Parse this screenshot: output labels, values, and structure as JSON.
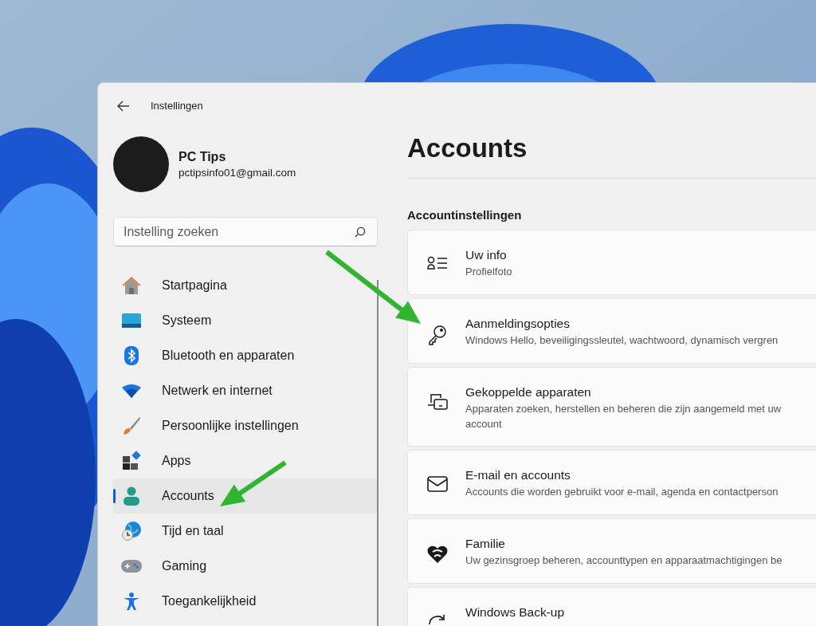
{
  "window": {
    "title": "Instellingen"
  },
  "profile": {
    "name": "PC Tips",
    "email": "pctipsinfo01@gmail.com"
  },
  "search": {
    "placeholder": "Instelling zoeken"
  },
  "nav": [
    {
      "label": "Startpagina",
      "selected": false
    },
    {
      "label": "Systeem",
      "selected": false
    },
    {
      "label": "Bluetooth en apparaten",
      "selected": false
    },
    {
      "label": "Netwerk en internet",
      "selected": false
    },
    {
      "label": "Persoonlijke instellingen",
      "selected": false
    },
    {
      "label": "Apps",
      "selected": false
    },
    {
      "label": "Accounts",
      "selected": true
    },
    {
      "label": "Tijd en taal",
      "selected": false
    },
    {
      "label": "Gaming",
      "selected": false
    },
    {
      "label": "Toegankelijkheid",
      "selected": false
    }
  ],
  "page": {
    "title": "Accounts",
    "section": "Accountinstellingen"
  },
  "cards": [
    {
      "title": "Uw info",
      "description": "Profielfoto"
    },
    {
      "title": "Aanmeldingsopties",
      "description": "Windows Hello, beveiligingssleutel, wachtwoord, dynamisch vergren"
    },
    {
      "title": "Gekoppelde apparaten",
      "description": "Apparaten zoeken, herstellen en beheren die zijn aangemeld met uw account"
    },
    {
      "title": "E-mail en accounts",
      "description": "Accounts die worden gebruikt voor e-mail, agenda en contactperson"
    },
    {
      "title": "Familie",
      "description": "Uw gezinsgroep beheren, accounttypen en apparaatmachtigingen be"
    },
    {
      "title": "Windows Back-up"
    }
  ]
}
